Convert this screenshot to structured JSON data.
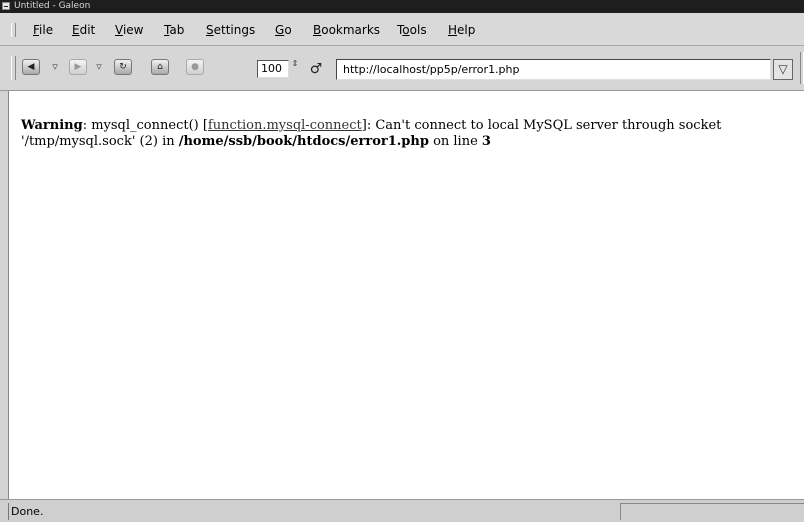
{
  "window": {
    "title": "Untitled - Galeon"
  },
  "menubar": {
    "items": [
      {
        "pre": "",
        "key": "F",
        "post": "ile"
      },
      {
        "pre": "",
        "key": "E",
        "post": "dit"
      },
      {
        "pre": "",
        "key": "V",
        "post": "iew"
      },
      {
        "pre": "",
        "key": "T",
        "post": "ab"
      },
      {
        "pre": "",
        "key": "S",
        "post": "ettings"
      },
      {
        "pre": "",
        "key": "G",
        "post": "o"
      },
      {
        "pre": "",
        "key": "B",
        "post": "ookmarks"
      },
      {
        "pre": "T",
        "key": "o",
        "post": "ols"
      },
      {
        "pre": "",
        "key": "H",
        "post": "elp"
      }
    ]
  },
  "toolbar": {
    "buttons": [
      {
        "name": "back-icon",
        "glyph": "◀"
      },
      {
        "name": "forward-icon",
        "glyph": "▶"
      },
      {
        "name": "reload-icon",
        "glyph": "↻"
      },
      {
        "name": "home-icon",
        "glyph": "⌂"
      },
      {
        "name": "stop-icon",
        "glyph": "●"
      }
    ],
    "zoom_value": "100",
    "spin_glyph": "⇕",
    "url_icon_glyph": "♂",
    "url": "http://localhost/pp5p/error1.php",
    "url_dropdown_glyph": "▽"
  },
  "content": {
    "label": "Warning",
    "text1": ": mysql_connect() [",
    "link": "function.mysql-connect",
    "text2": "]: Can't connect to local MySQL server through socket '/tmp/mysql.sock' (2) in ",
    "path": "/home/ssb/book/htdocs/error1.php",
    "text3": " on line ",
    "line": "3"
  },
  "statusbar": {
    "text": "Done."
  }
}
